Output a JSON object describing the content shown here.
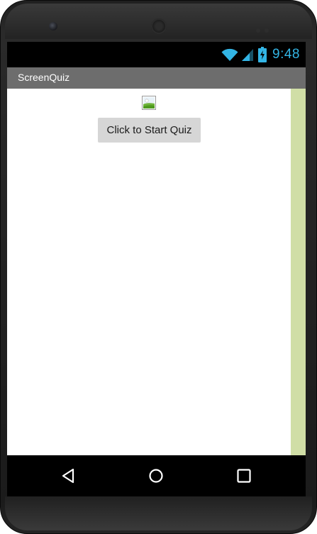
{
  "status_bar": {
    "time": "9:48",
    "icons": [
      "wifi-icon",
      "cell-signal-icon",
      "battery-charging-icon"
    ],
    "icon_color": "#33b5e5"
  },
  "app": {
    "title": "ScreenQuiz",
    "start_button_label": "Click to Start Quiz",
    "image_icon": "image-placeholder-icon"
  },
  "nav_bar": {
    "buttons": [
      "back-icon",
      "home-icon",
      "recents-icon"
    ]
  },
  "colors": {
    "title_bar": "#6d6d6d",
    "side_strip": "#d0dea6",
    "button_bg": "#d6d6d6"
  }
}
